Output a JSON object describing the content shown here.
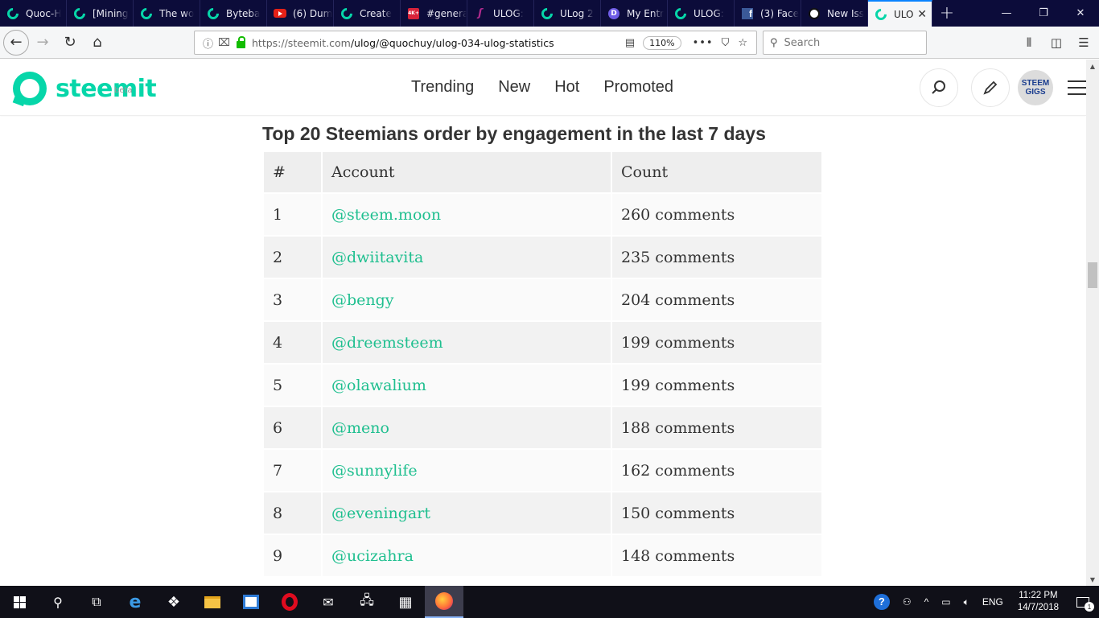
{
  "browser": {
    "tabs": [
      {
        "label": "Quoc-H",
        "icon": "steemit-icon"
      },
      {
        "label": "[Mining",
        "icon": "steemit-icon"
      },
      {
        "label": "The wo",
        "icon": "steemit-icon"
      },
      {
        "label": "Byteba",
        "icon": "steemit-icon"
      },
      {
        "label": "(6) Dum",
        "icon": "youtube-icon"
      },
      {
        "label": "Create",
        "icon": "steemit-icon"
      },
      {
        "label": "#genera",
        "icon": "4k-icon"
      },
      {
        "label": "ULOG:",
        "icon": "s-icon"
      },
      {
        "label": "ULog 2",
        "icon": "steemit-icon"
      },
      {
        "label": "My Entr",
        "icon": "d-icon"
      },
      {
        "label": "ULOG:",
        "icon": "steemit-icon"
      },
      {
        "label": "(3) Face",
        "icon": "facebook-icon"
      },
      {
        "label": "New Iss",
        "icon": "github-icon"
      }
    ],
    "active_tab": {
      "label": "ULO",
      "icon": "steemit-icon"
    },
    "url_host": "https://steemit.com",
    "url_path": "/ulog/@quochuy/ulog-034-ulog-statistics",
    "zoom": "110%",
    "search_placeholder": "Search"
  },
  "site": {
    "logo_text": "steemit",
    "logo_badge": "beta",
    "nav": [
      "Trending",
      "New",
      "Hot",
      "Promoted"
    ],
    "avatar_text": [
      "STEEM",
      "GIGS"
    ],
    "brand_color": "#06d6a9"
  },
  "article": {
    "heading": "Top 20 Steemians order by engagement in the last 7 days",
    "table": {
      "headers": [
        "#",
        "Account",
        "Count"
      ],
      "rows": [
        [
          "1",
          "@steem.moon",
          "260 comments"
        ],
        [
          "2",
          "@dwiitavita",
          "235 comments"
        ],
        [
          "3",
          "@bengy",
          "204 comments"
        ],
        [
          "4",
          "@dreemsteem",
          "199 comments"
        ],
        [
          "5",
          "@olawalium",
          "199 comments"
        ],
        [
          "6",
          "@meno",
          "188 comments"
        ],
        [
          "7",
          "@sunnylife",
          "162 comments"
        ],
        [
          "8",
          "@eveningart",
          "150 comments"
        ],
        [
          "9",
          "@ucizahra",
          "148 comments"
        ]
      ]
    }
  },
  "taskbar": {
    "lang": "ENG",
    "time": "11:22 PM",
    "date": "14/7/2018",
    "notification_count": "1"
  }
}
